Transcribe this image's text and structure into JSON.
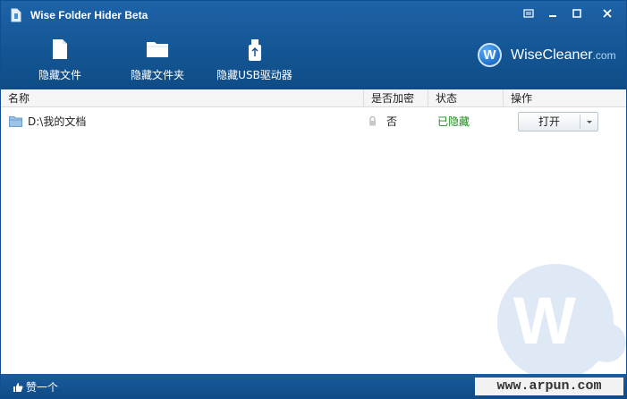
{
  "window": {
    "title": "Wise Folder Hider Beta",
    "controls": [
      "menu",
      "minimize",
      "maximize",
      "close"
    ]
  },
  "toolbar": {
    "items": [
      {
        "label": "隐藏文件",
        "icon": "file-icon"
      },
      {
        "label": "隐藏文件夹",
        "icon": "folder-icon"
      },
      {
        "label": "隐藏USB驱动器",
        "icon": "usb-drive-icon"
      }
    ]
  },
  "brand": {
    "name": "WiseCleaner",
    "suffix": ".com",
    "logo_letter": "W"
  },
  "table": {
    "columns": [
      "名称",
      "是否加密",
      "状态",
      "操作"
    ],
    "rows": [
      {
        "name": "D:\\我的文档",
        "encrypted": "否",
        "status": "已隐藏",
        "action": "打开"
      }
    ]
  },
  "watermark": {
    "letter": "W"
  },
  "statusbar": {
    "like_label": "赞一个",
    "site": "www.arpun.com"
  },
  "colors": {
    "header": "#135593",
    "status_hidden": "#1a8a1a",
    "accent": "#1f6fc6"
  }
}
